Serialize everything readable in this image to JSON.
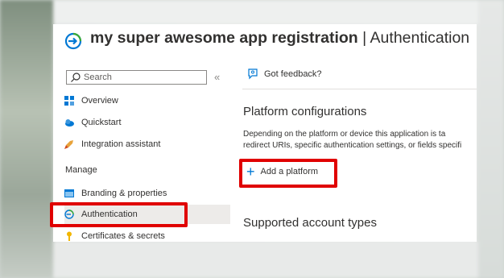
{
  "header": {
    "app_name": "my super awesome app registration",
    "separator": "|",
    "page": "Authentication"
  },
  "sidebar": {
    "search_placeholder": "Search",
    "collapse_glyph": "«",
    "items": [
      {
        "label": "Overview",
        "icon": "overview-grid-icon"
      },
      {
        "label": "Quickstart",
        "icon": "quickstart-cloud-icon"
      },
      {
        "label": "Integration assistant",
        "icon": "rocket-icon"
      }
    ],
    "section": "Manage",
    "manage_items": [
      {
        "label": "Branding & properties",
        "icon": "branding-icon"
      },
      {
        "label": "Authentication",
        "icon": "authentication-icon",
        "selected": true
      },
      {
        "label": "Certificates & secrets",
        "icon": "key-icon"
      }
    ]
  },
  "main": {
    "feedback_label": "Got feedback?",
    "platform_heading": "Platform configurations",
    "platform_desc_line1": "Depending on the platform or device this application is ta",
    "platform_desc_line2": "redirect URIs, specific authentication settings, or fields specifi",
    "add_platform_label": "Add a platform",
    "account_types_heading": "Supported account types"
  },
  "colors": {
    "accent": "#0078d4",
    "highlight": "#e00000",
    "selected_bg": "#edebe9"
  }
}
